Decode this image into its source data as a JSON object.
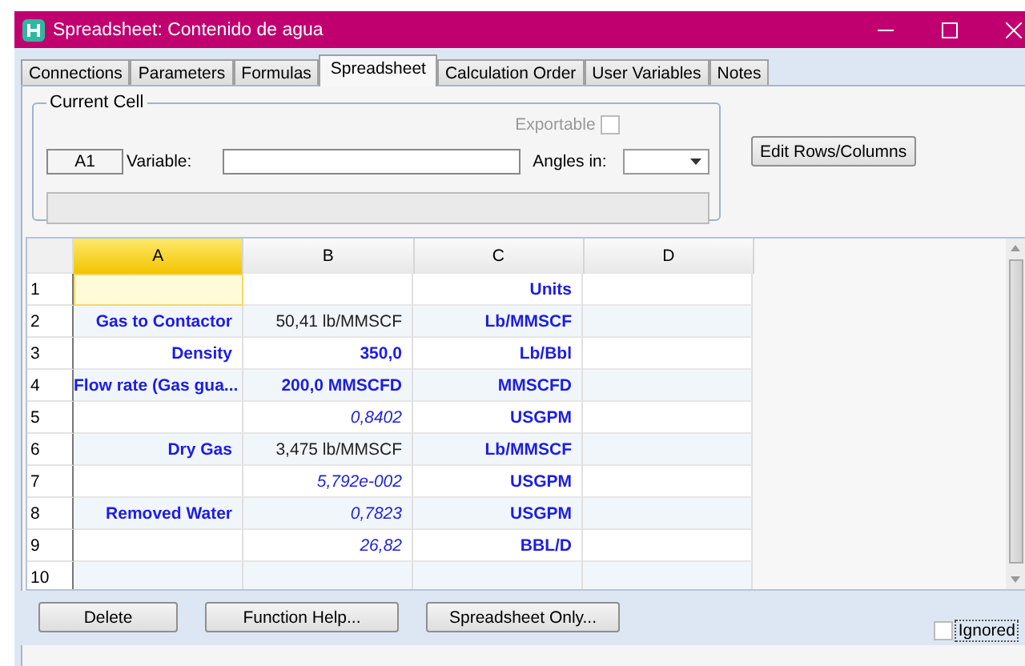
{
  "window": {
    "title": "Spreadsheet: Contenido de agua"
  },
  "tabs": [
    {
      "label": "Connections",
      "selected": false
    },
    {
      "label": "Parameters",
      "selected": false
    },
    {
      "label": "Formulas",
      "selected": false
    },
    {
      "label": "Spreadsheet",
      "selected": true
    },
    {
      "label": "Calculation Order",
      "selected": false
    },
    {
      "label": "User Variables",
      "selected": false
    },
    {
      "label": "Notes",
      "selected": false
    }
  ],
  "current_cell": {
    "legend": "Current Cell",
    "exportable_label": "Exportable",
    "exportable_checked": false,
    "cell": "A1",
    "variable_label": "Variable:",
    "angles_label": "Angles in:"
  },
  "edit_button": "Edit Rows/Columns",
  "grid": {
    "columns": [
      {
        "label": "A",
        "selected": true
      },
      {
        "label": "B",
        "selected": false
      },
      {
        "label": "C",
        "selected": false
      },
      {
        "label": "D",
        "selected": false
      }
    ],
    "rows": [
      {
        "label": "1",
        "cells": [
          {
            "selected": true
          },
          {
            "selected": false
          },
          {
            "text": "Units",
            "kind": "label",
            "selected": false
          },
          {
            "selected": false
          }
        ]
      },
      {
        "label": "2",
        "cells": [
          {
            "text": "Gas to Contactor",
            "kind": "label",
            "selected": false
          },
          {
            "text": "50,41 lb/MMSCF",
            "kind": "value",
            "selected": false
          },
          {
            "text": "Lb/MMSCF",
            "kind": "label",
            "selected": false
          },
          {
            "selected": false
          }
        ]
      },
      {
        "label": "3",
        "cells": [
          {
            "text": "Density",
            "kind": "label",
            "selected": false
          },
          {
            "text": "350,0",
            "kind": "label",
            "selected": false
          },
          {
            "text": "Lb/Bbl",
            "kind": "label",
            "selected": false
          },
          {
            "selected": false
          }
        ]
      },
      {
        "label": "4",
        "cells": [
          {
            "text": "Flow rate (Gas gua...",
            "kind": "label",
            "selected": false
          },
          {
            "text": "200,0 MMSCFD",
            "kind": "label",
            "selected": false
          },
          {
            "text": "MMSCFD",
            "kind": "label",
            "selected": false
          },
          {
            "selected": false
          }
        ]
      },
      {
        "label": "5",
        "cells": [
          {
            "selected": false
          },
          {
            "text": "0,8402",
            "kind": "formula",
            "selected": false
          },
          {
            "text": "USGPM",
            "kind": "label",
            "selected": false
          },
          {
            "selected": false
          }
        ]
      },
      {
        "label": "6",
        "cells": [
          {
            "text": "Dry Gas",
            "kind": "label",
            "selected": false
          },
          {
            "text": "3,475 lb/MMSCF",
            "kind": "value",
            "selected": false
          },
          {
            "text": "Lb/MMSCF",
            "kind": "label",
            "selected": false
          },
          {
            "selected": false
          }
        ]
      },
      {
        "label": "7",
        "cells": [
          {
            "selected": false
          },
          {
            "text": "5,792e-002",
            "kind": "formula",
            "selected": false
          },
          {
            "text": "USGPM",
            "kind": "label",
            "selected": false
          },
          {
            "selected": false
          }
        ]
      },
      {
        "label": "8",
        "cells": [
          {
            "text": "Removed Water",
            "kind": "label",
            "selected": false
          },
          {
            "text": "0,7823",
            "kind": "formula",
            "selected": false
          },
          {
            "text": "USGPM",
            "kind": "label",
            "selected": false
          },
          {
            "selected": false
          }
        ]
      },
      {
        "label": "9",
        "cells": [
          {
            "selected": false
          },
          {
            "text": "26,82",
            "kind": "formula",
            "selected": false
          },
          {
            "text": "BBL/D",
            "kind": "label",
            "selected": false
          },
          {
            "selected": false
          }
        ]
      },
      {
        "label": "10",
        "cells": [
          {
            "selected": false
          },
          {
            "selected": false
          },
          {
            "selected": false
          },
          {
            "selected": false
          }
        ]
      }
    ]
  },
  "buttons": [
    "Delete",
    "Function Help...",
    "Spreadsheet Only..."
  ],
  "ignored": {
    "label": "Ignored",
    "checked": false
  }
}
